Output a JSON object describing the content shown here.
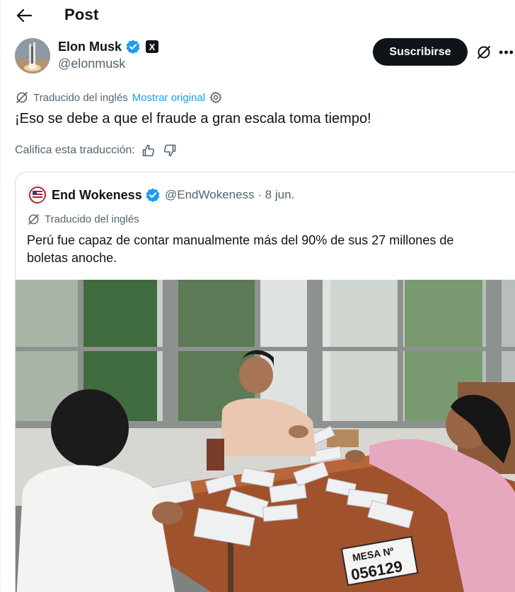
{
  "header": {
    "title": "Post"
  },
  "author": {
    "name": "Elon Musk",
    "handle": "@elonmusk",
    "affiliate_badge": "X"
  },
  "actions": {
    "subscribe_label": "Suscribirse",
    "more_label": "•••"
  },
  "translation": {
    "label": "Traducido del inglés",
    "show_original": "Mostrar original"
  },
  "tweet": {
    "text": "¡Eso se debe a que el fraude a gran escala toma tiempo!"
  },
  "rate": {
    "label": "Califica esta traducción:"
  },
  "quote": {
    "name": "End Wokeness",
    "handle": "@EndWokeness · 8 jun.",
    "translated_label": "Traducido del inglés",
    "text": "Perú fue capaz de contar manualmente más del 90% de sus 27 millones de boletas anoche.",
    "sign_text": "MESA Nº",
    "sign_number": "056129"
  },
  "icons": {
    "back": "arrow-left-icon",
    "verified": "verified-badge-icon",
    "grok": "grok-icon",
    "translate": "translate-icon",
    "settings": "gear-icon",
    "thumbs_up": "thumbs-up-icon",
    "thumbs_down": "thumbs-down-icon"
  },
  "colors": {
    "accent": "#1d9bf0",
    "text_primary": "#0f1419",
    "text_secondary": "#536471",
    "border": "#cfd9de",
    "button_dark": "#0f1419"
  }
}
